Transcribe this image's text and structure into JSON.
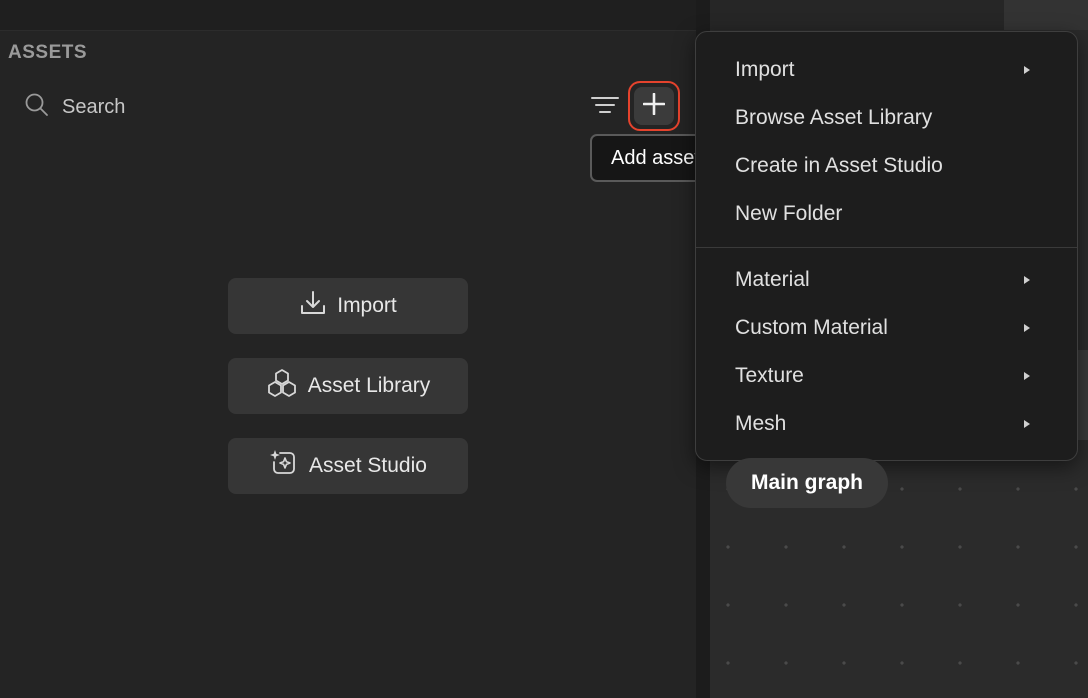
{
  "assets_panel": {
    "title": "ASSETS",
    "search_placeholder": "Search",
    "tooltip": "Add asset",
    "buttons": {
      "import": "Import",
      "asset_library": "Asset Library",
      "asset_studio": "Asset Studio"
    }
  },
  "add_menu": {
    "items": [
      {
        "label": "Import",
        "submenu": true
      },
      {
        "label": "Browse Asset Library",
        "submenu": false
      },
      {
        "label": "Create in Asset Studio",
        "submenu": false
      },
      {
        "label": "New Folder",
        "submenu": false
      },
      {
        "label": "Material",
        "submenu": true
      },
      {
        "label": "Custom Material",
        "submenu": true
      },
      {
        "label": "Texture",
        "submenu": true
      },
      {
        "label": "Mesh",
        "submenu": true
      }
    ]
  },
  "graph": {
    "tab_label": "Main graph"
  },
  "colors": {
    "highlight": "#e5432d",
    "menu_bg": "#1d1d1d",
    "panel_bg": "#242424"
  }
}
